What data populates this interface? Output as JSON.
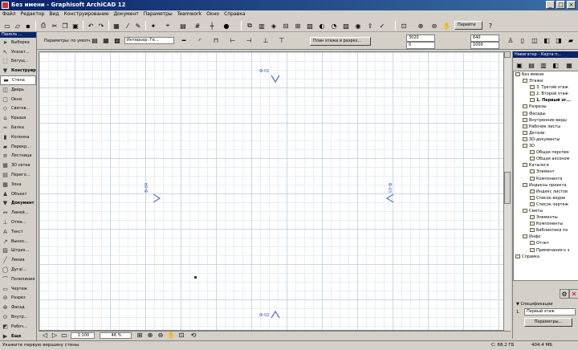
{
  "window": {
    "title": "Без имени - Graphisoft ArchiCAD 12",
    "controls": [
      "_",
      "□",
      "×"
    ]
  },
  "menubar": [
    "Файл",
    "Редактор",
    "Вид",
    "Конструирование",
    "Документ",
    "Параметры",
    "Teamwork",
    "Окно",
    "Справка"
  ],
  "infobox": {
    "params_label": "Параметры: по умолч.",
    "view_label": "Интерьер: Ге...",
    "floor_button": "План этажа и разрез...",
    "field_1": "3020",
    "field_2": "0",
    "field_3": "640",
    "field_4": "1000",
    "goto_label": "Перейти"
  },
  "toolbox": {
    "title": "Панель ...",
    "items": [
      {
        "label": "Выборка",
        "icon": "arrow-icon",
        "group": false
      },
      {
        "label": "Указат...",
        "icon": "pointer-icon",
        "group": false
      },
      {
        "label": "Бегущ...",
        "icon": "marquee-icon",
        "group": false
      },
      {
        "label": "Конструир...",
        "icon": "triangle-down-icon",
        "group": true
      },
      {
        "label": "Стена",
        "icon": "wall-icon",
        "group": false,
        "selected": true
      },
      {
        "label": "Дверь",
        "icon": "door-icon",
        "group": false
      },
      {
        "label": "Окно",
        "icon": "window-icon",
        "group": false
      },
      {
        "label": "Светов...",
        "icon": "skylight-icon",
        "group": false
      },
      {
        "label": "Крыша",
        "icon": "roof-icon",
        "group": false
      },
      {
        "label": "Балка",
        "icon": "beam-icon",
        "group": false
      },
      {
        "label": "Колонна",
        "icon": "column-icon",
        "group": false
      },
      {
        "label": "Перекр...",
        "icon": "slab-icon",
        "group": false
      },
      {
        "label": "Лестница",
        "icon": "stair-icon",
        "group": false
      },
      {
        "label": "3D сетка",
        "icon": "mesh-icon",
        "group": false
      },
      {
        "label": "Перего...",
        "icon": "curtain-icon",
        "group": false
      },
      {
        "label": "Зона",
        "icon": "zone-icon",
        "group": false
      },
      {
        "label": "Объект",
        "icon": "object-icon",
        "group": false
      },
      {
        "label": "Документ",
        "icon": "triangle-down-icon",
        "group": true
      },
      {
        "label": "Линей...",
        "icon": "dimension-icon",
        "group": false
      },
      {
        "label": "Отме...",
        "icon": "level-icon",
        "group": false
      },
      {
        "label": "Текст",
        "icon": "text-icon",
        "group": false
      },
      {
        "label": "Вынос...",
        "icon": "label-icon",
        "group": false
      },
      {
        "label": "Штрих...",
        "icon": "fill-icon",
        "group": false
      },
      {
        "label": "Линия",
        "icon": "line-icon",
        "group": false
      },
      {
        "label": "Дуга/...",
        "icon": "arc-icon",
        "group": false
      },
      {
        "label": "Полилиния",
        "icon": "polyline-icon",
        "group": false
      },
      {
        "label": "Чертеж",
        "icon": "drawing-icon",
        "group": false
      },
      {
        "label": "Разрез",
        "icon": "section-icon",
        "group": false
      },
      {
        "label": "Фасад",
        "icon": "elevation-icon",
        "group": false
      },
      {
        "label": "Внутр...",
        "icon": "interior-icon",
        "group": false
      },
      {
        "label": "Рабоч...",
        "icon": "worksheet-icon",
        "group": false
      },
      {
        "label": "Еще",
        "icon": "triangle-right-icon",
        "group": true
      }
    ]
  },
  "canvas": {
    "markers": [
      "Ф-01",
      "Ф-02",
      "Ф-03",
      "Ф-04"
    ],
    "scale": "1:100",
    "zoom": "46 %"
  },
  "navigator": {
    "title": "Навигатор - Карта п...",
    "tree": [
      {
        "label": "Без имени",
        "level": 0
      },
      {
        "label": "Этажи",
        "level": 1
      },
      {
        "label": "3. Третий этаж",
        "level": 2
      },
      {
        "label": "2. Второй этаж",
        "level": 2
      },
      {
        "label": "1. Первый эт...",
        "level": 2,
        "bold": true
      },
      {
        "label": "Разрезы",
        "level": 1
      },
      {
        "label": "Фасады",
        "level": 1
      },
      {
        "label": "Внутренние виды",
        "level": 1
      },
      {
        "label": "Рабочие листы",
        "level": 1
      },
      {
        "label": "Детали",
        "level": 1
      },
      {
        "label": "3D-документы",
        "level": 1
      },
      {
        "label": "3D",
        "level": 1
      },
      {
        "label": "Общая перспек",
        "level": 2
      },
      {
        "label": "Общая аксоном",
        "level": 2
      },
      {
        "label": "Каталоги",
        "level": 1
      },
      {
        "label": "Элемент",
        "level": 2
      },
      {
        "label": "Компонента",
        "level": 2
      },
      {
        "label": "Индексы проекта",
        "level": 1
      },
      {
        "label": "Индекс листов",
        "level": 2
      },
      {
        "label": "Список видов",
        "level": 2
      },
      {
        "label": "Список чертеж",
        "level": 2
      },
      {
        "label": "Сметы",
        "level": 1
      },
      {
        "label": "Элементы",
        "level": 2
      },
      {
        "label": "Компоненты",
        "level": 2
      },
      {
        "label": "Библиотека по",
        "level": 2
      },
      {
        "label": "Инфо",
        "level": 1
      },
      {
        "label": "Отчет",
        "level": 2
      },
      {
        "label": "Примечания к з",
        "level": 2
      },
      {
        "label": "Справка",
        "level": 0
      }
    ],
    "spec_title": "Спецификации",
    "spec_field": "Первый этаж",
    "spec_num": "1.",
    "params_button": "Параметры..."
  },
  "status": {
    "hint": "Укажите первую вершину стены.",
    "disk": "С: 68.2 ГБ",
    "memory": "404.4 МБ"
  }
}
